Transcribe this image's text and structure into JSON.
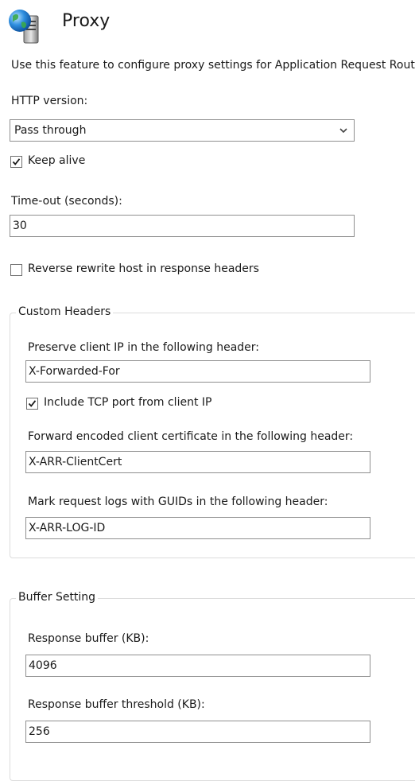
{
  "header": {
    "title": "Proxy",
    "icon": "globe-server-icon",
    "description": "Use this feature to configure proxy settings for Application Request Routing."
  },
  "http_version": {
    "label": "HTTP version:",
    "selected": "Pass through"
  },
  "keep_alive": {
    "label": "Keep alive",
    "checked": true
  },
  "timeout": {
    "label": "Time-out (seconds):",
    "value": "30"
  },
  "reverse_rewrite": {
    "label": "Reverse rewrite host in response headers",
    "checked": false
  },
  "custom_headers": {
    "legend": "Custom Headers",
    "preserve_ip_label": "Preserve client IP in the following header:",
    "preserve_ip_value": "X-Forwarded-For",
    "include_tcp_label": "Include TCP port from client IP",
    "include_tcp_checked": true,
    "client_cert_label": "Forward encoded client certificate in the following header:",
    "client_cert_value": "X-ARR-ClientCert",
    "log_guid_label": "Mark request logs with GUIDs in the following header:",
    "log_guid_value": "X-ARR-LOG-ID"
  },
  "buffer_setting": {
    "legend": "Buffer Setting",
    "response_buffer_label": "Response buffer (KB):",
    "response_buffer_value": "4096",
    "threshold_label": "Response buffer threshold (KB):",
    "threshold_value": "256"
  }
}
